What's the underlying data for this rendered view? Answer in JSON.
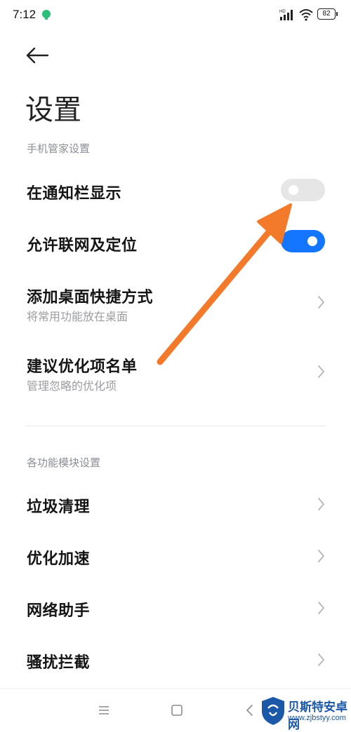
{
  "status_bar": {
    "time": "7:12",
    "battery": "82",
    "signal_label": "HD"
  },
  "header": {
    "title": "设置"
  },
  "sections": {
    "phone_manager": {
      "header": "手机管家设置",
      "items": [
        {
          "title": "在通知栏显示",
          "toggle": "off"
        },
        {
          "title": "允许联网及定位",
          "toggle": "on"
        },
        {
          "title": "添加桌面快捷方式",
          "subtitle": "将常用功能放在桌面"
        },
        {
          "title": "建议优化项名单",
          "subtitle": "管理忽略的优化项"
        }
      ]
    },
    "modules": {
      "header": "各功能模块设置",
      "items": [
        {
          "title": "垃圾清理"
        },
        {
          "title": "优化加速"
        },
        {
          "title": "网络助手"
        },
        {
          "title": "骚扰拦截"
        }
      ]
    }
  },
  "colors": {
    "accent": "#1476ff",
    "annotation_arrow": "#f47a2b",
    "toggle_off": "#e6e6e6"
  },
  "watermark": {
    "name": "贝斯特安卓网",
    "url": "www.zjbstyy.com"
  },
  "icons": [
    "back-arrow-icon",
    "chevron-right-icon",
    "menu-icon",
    "home-square-icon",
    "back-triangle-icon"
  ]
}
